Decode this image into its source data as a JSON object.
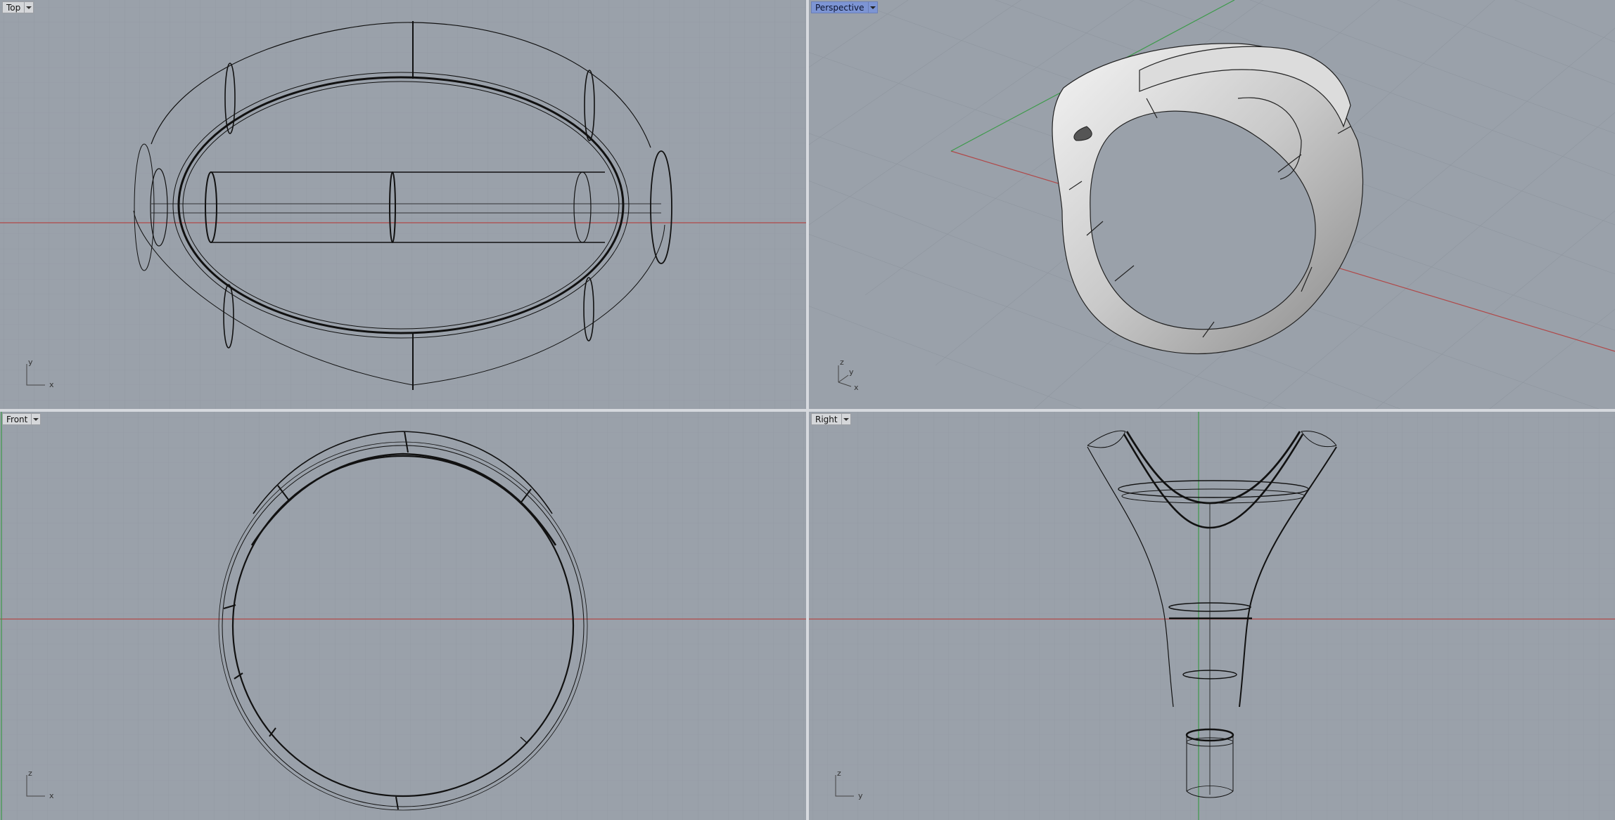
{
  "viewports": {
    "top": {
      "title": "Top",
      "axis_h": "x",
      "axis_v": "y"
    },
    "perspective": {
      "title": "Perspective",
      "axis_1": "z",
      "axis_2": "y",
      "axis_3": "x"
    },
    "front": {
      "title": "Front",
      "axis_h": "x",
      "axis_v": "z"
    },
    "right": {
      "title": "Right",
      "axis_h": "y",
      "axis_v": "z"
    }
  },
  "icons": {
    "menu_arrow": "chevron-down-icon"
  },
  "colors": {
    "viewport_bg": "#9aa1aa",
    "grid": "#8e959e",
    "x_axis": "#b04848",
    "y_axis": "#3d9a4a",
    "active_tab": "#7d95d4",
    "curve": "#111111",
    "separator": "#e6e8eb"
  }
}
